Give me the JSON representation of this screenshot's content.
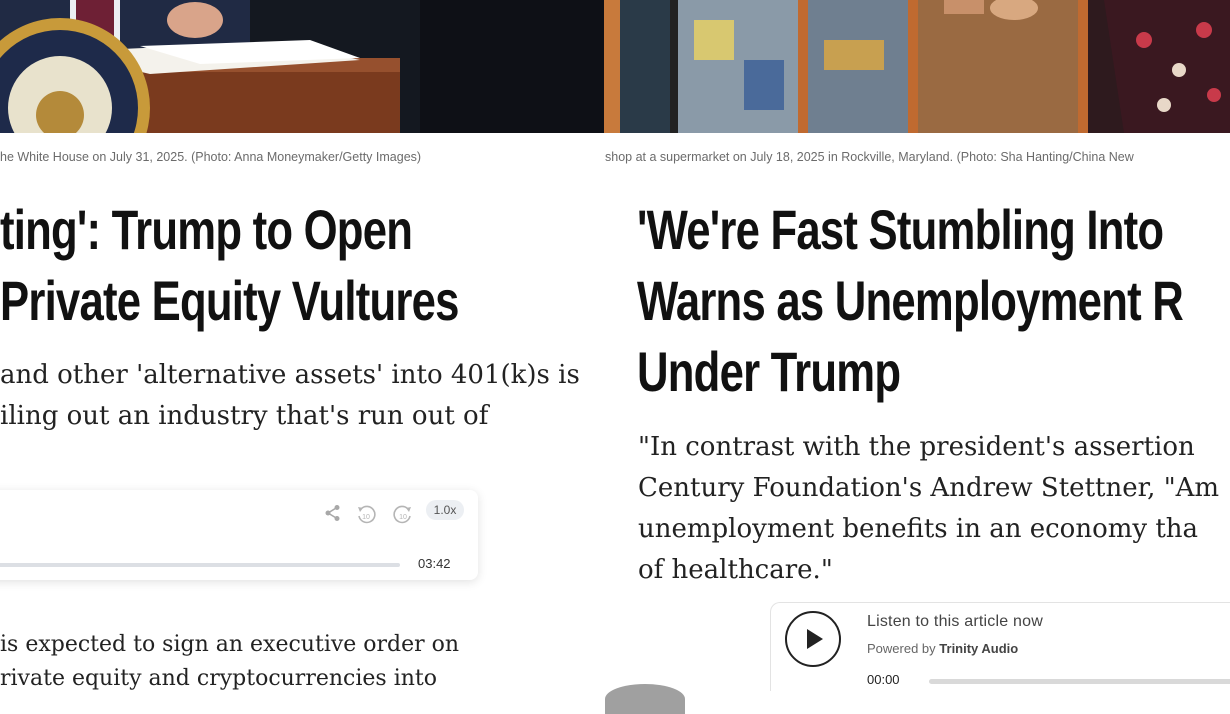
{
  "left_article": {
    "caption": "he White House on July 31, 2025.     (Photo: Anna Moneymaker/Getty Images)",
    "headline_lines": [
      "ting': Trump to Open",
      "Private Equity Vultures"
    ],
    "dek_lines": [
      "and other 'alternative assets' into 401(k)s is",
      "iling out an industry that's run out of"
    ],
    "body_lines": [
      "is expected to sign an executive order on",
      "rivate equity and cryptocurrencies into"
    ],
    "player": {
      "speed": "1.0x",
      "duration": "03:42",
      "icons": [
        "share-icon",
        "rewind-10-icon",
        "forward-10-icon"
      ]
    }
  },
  "right_article": {
    "caption": "shop at a supermarket on July 18, 2025 in Rockville, Maryland.     (Photo: Sha Hanting/China New",
    "headline_lines": [
      "'We're Fast Stumbling Into",
      "Warns as Unemployment R",
      "Under Trump"
    ],
    "dek_lines": [
      "\"In contrast with the president's assertion",
      "Century Foundation's Andrew Stettner, \"Am",
      "unemployment benefits in an economy tha",
      "of healthcare.\""
    ],
    "player": {
      "listen_label": "Listen to this article now",
      "powered_prefix": "Powered by",
      "powered_brand": "Trinity Audio",
      "current_time": "00:00",
      "icons": [
        "play-icon"
      ]
    }
  },
  "colors": {
    "headline": "#111111",
    "caption": "#6b6b6b",
    "muted_icon": "#a8a8a8"
  }
}
